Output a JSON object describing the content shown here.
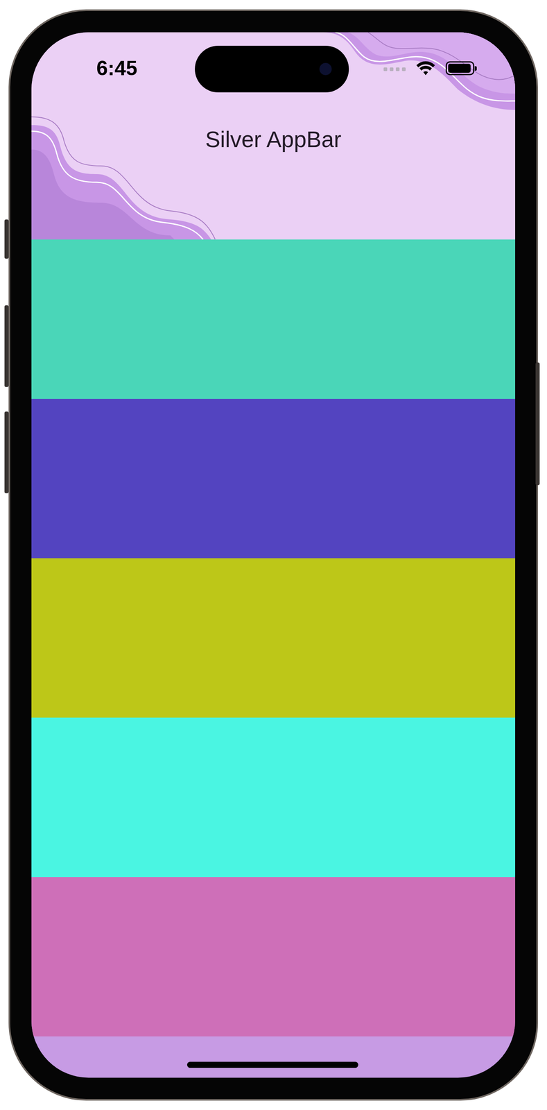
{
  "status_bar": {
    "time": "6:45",
    "signal": {
      "level": 0
    },
    "battery": {
      "level": 0.95
    }
  },
  "app_bar": {
    "title": "Silver AppBar"
  },
  "list": {
    "items": [
      {
        "color": "#4ad6b8"
      },
      {
        "color": "#5344c0"
      },
      {
        "color": "#bdc718"
      },
      {
        "color": "#4af5e2"
      },
      {
        "color": "#ce6fb8"
      }
    ]
  }
}
